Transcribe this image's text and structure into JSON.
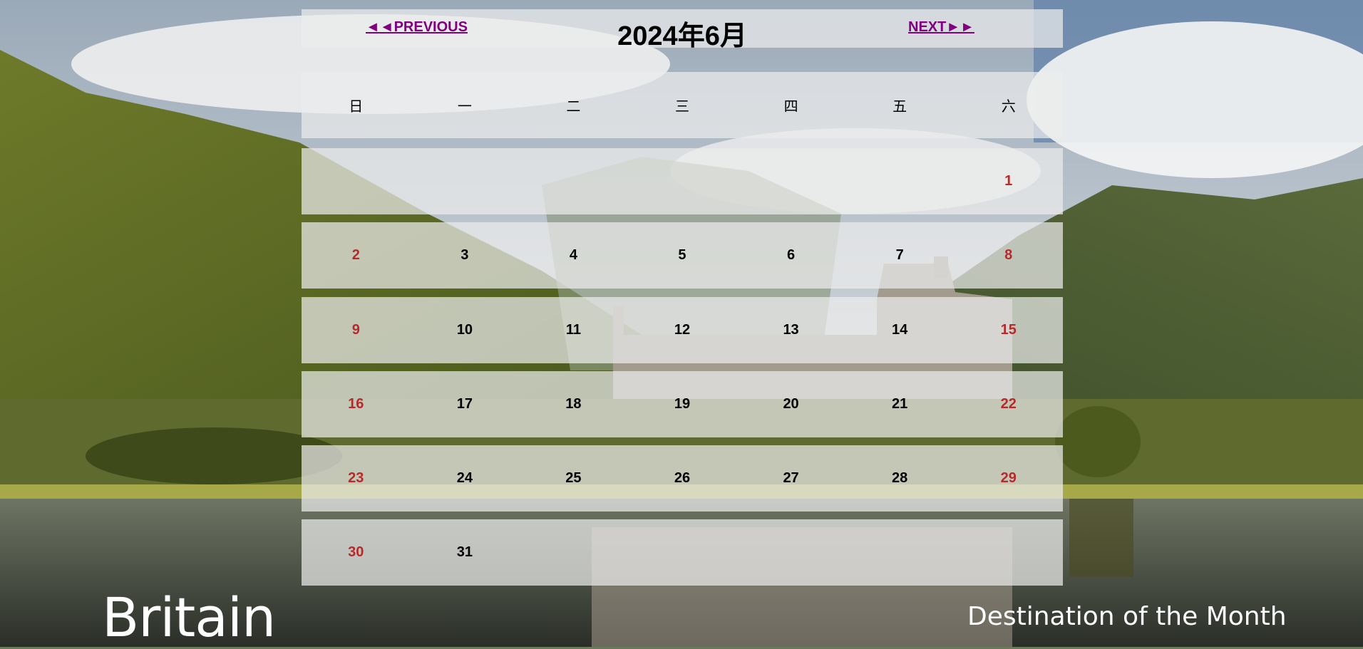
{
  "nav": {
    "prev_label": "◄◄PREVIOUS",
    "next_label": "NEXT►►",
    "month_title": "2024年6月"
  },
  "weekdays": [
    "日",
    "一",
    "二",
    "三",
    "四",
    "五",
    "六"
  ],
  "weeks": [
    [
      "",
      "",
      "",
      "",
      "",
      "",
      "1"
    ],
    [
      "2",
      "3",
      "4",
      "5",
      "6",
      "7",
      "8"
    ],
    [
      "9",
      "10",
      "11",
      "12",
      "13",
      "14",
      "15"
    ],
    [
      "16",
      "17",
      "18",
      "19",
      "20",
      "21",
      "22"
    ],
    [
      "23",
      "24",
      "25",
      "26",
      "27",
      "28",
      "29"
    ],
    [
      "30",
      "31",
      "",
      "",
      "",
      "",
      ""
    ]
  ],
  "banner": {
    "destination": "Britain",
    "tagline": "Destination of the Month"
  },
  "colors": {
    "link": "#800080",
    "weekend": "#b52b2b",
    "panel": "rgba(235,235,235,0.72)"
  }
}
